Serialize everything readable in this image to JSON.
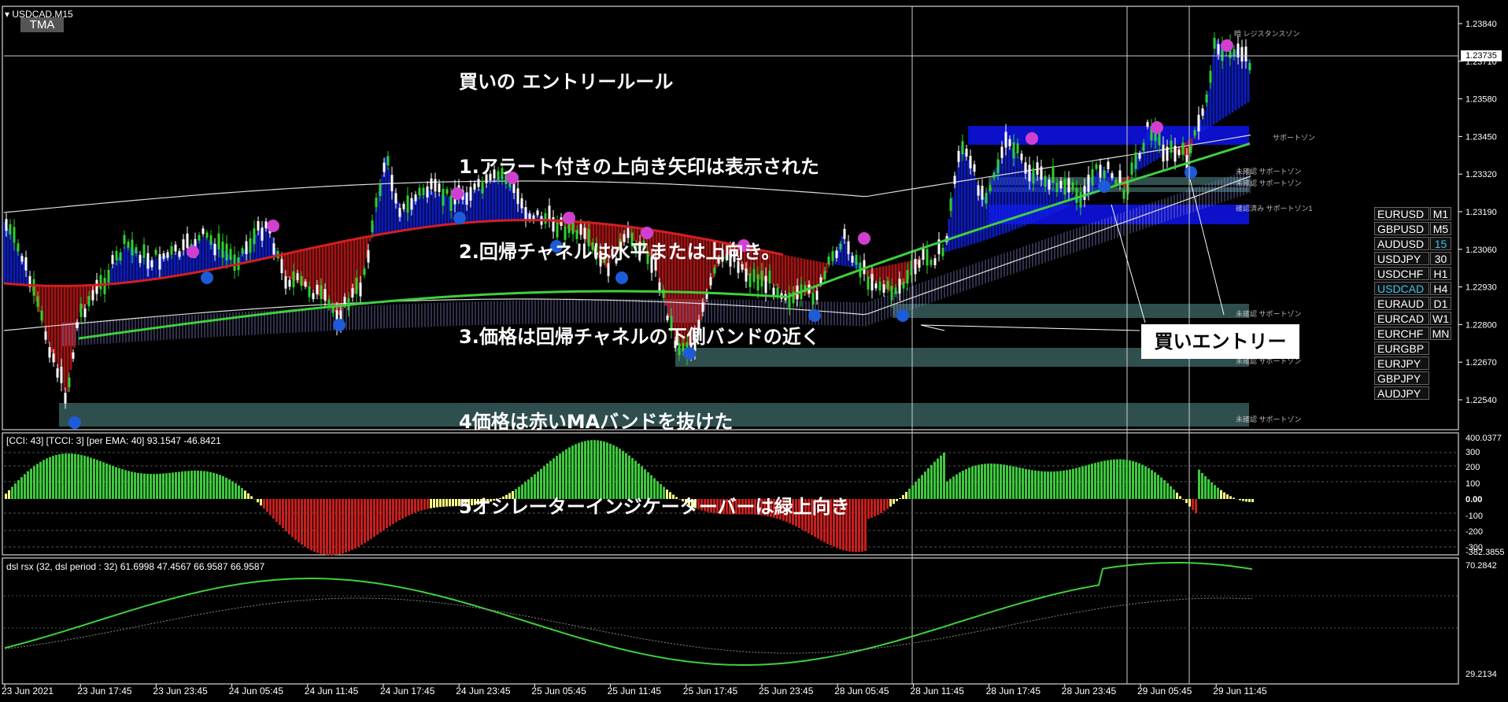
{
  "window": {
    "title": "USDCAD,M15",
    "indicator_box": "TMA"
  },
  "rules": {
    "lines": [
      "買いの エントリールール",
      "1.アラート付きの上向き矢印は表示された",
      "2.回帰チャネルは水平または上向き。",
      "3.価格は回帰チャネルの下側バンドの近く",
      "4価格は赤いMAバンドを抜けた",
      "5オシレーターインジケーターバーは緑上向き"
    ]
  },
  "entry_label": "買いエントリー",
  "price_axis": {
    "labels": [
      "1.23840",
      "1.23710",
      "1.23580",
      "1.23450",
      "1.23320",
      "1.23190",
      "1.23060",
      "1.22930",
      "1.22800",
      "1.22670",
      "1.22540"
    ],
    "current_price": "1.23735"
  },
  "zone_labels": {
    "top_right": "暗 レジスタンスゾン",
    "support_1": "サポートゾン",
    "support_2": "未確認 サポートゾン",
    "support_3": "未確認 サポートゾン",
    "support_4": "確認済み サポートゾン1",
    "support_5": "未確認 サポートゾン",
    "support_6": "未確認 サポートゾン",
    "support_7": "未確認 サポートゾン"
  },
  "symbols": [
    {
      "pair": "EURUSD",
      "tf": "M1",
      "active": false,
      "tf_active": false
    },
    {
      "pair": "GBPUSD",
      "tf": "M5",
      "active": false,
      "tf_active": false
    },
    {
      "pair": "AUDUSD",
      "tf": "15",
      "active": false,
      "tf_active": true
    },
    {
      "pair": "USDJPY",
      "tf": "30",
      "active": false,
      "tf_active": false
    },
    {
      "pair": "USDCHF",
      "tf": "H1",
      "active": false,
      "tf_active": false
    },
    {
      "pair": "USDCAD",
      "tf": "H4",
      "active": true,
      "tf_active": false
    },
    {
      "pair": "EURAUD",
      "tf": "D1",
      "active": false,
      "tf_active": false
    },
    {
      "pair": "EURCAD",
      "tf": "W1",
      "active": false,
      "tf_active": false
    },
    {
      "pair": "EURCHF",
      "tf": "MN",
      "active": false,
      "tf_active": false
    },
    {
      "pair": "EURGBP",
      "tf": "",
      "active": false,
      "tf_active": false
    },
    {
      "pair": "EURJPY",
      "tf": "",
      "active": false,
      "tf_active": false
    },
    {
      "pair": "GBPJPY",
      "tf": "",
      "active": false,
      "tf_active": false
    },
    {
      "pair": "AUDJPY",
      "tf": "",
      "active": false,
      "tf_active": false
    }
  ],
  "cci": {
    "header": "[CCI: 43] [TCCI: 3] [per EMA: 40]  93.1547 -46.8421",
    "axis_labels": [
      "400.0377",
      "300",
      "200",
      "100",
      "0.00",
      "-100",
      "-200",
      "-300",
      "-382.3855"
    ]
  },
  "rsx": {
    "header": "dsl rsx (32, dsl period : 32) 61.6998 47.4567 66.9587 66.9587",
    "axis_labels": [
      "70.2842",
      "29.2134"
    ]
  },
  "time_axis": [
    "23 Jun 2021",
    "23 Jun 17:45",
    "23 Jun 23:45",
    "24 Jun 05:45",
    "24 Jun 11:45",
    "24 Jun 17:45",
    "24 Jun 23:45",
    "25 Jun 05:45",
    "25 Jun 11:45",
    "25 Jun 17:45",
    "25 Jun 23:45",
    "28 Jun 05:45",
    "28 Jun 11:45",
    "28 Jun 17:45",
    "28 Jun 23:45",
    "29 Jun 05:45",
    "29 Jun 11:45"
  ],
  "colors": {
    "bull_candle": "#2fd02f",
    "bear_candle": "#ffffff",
    "ma_red": "#d02020",
    "ma_green": "#3fd03f",
    "blue_band": "#1020e0",
    "red_band": "#c01818",
    "zone_gray": "#2f4f4f",
    "zone_blue": "#0c10c8",
    "buy_arrow": "#1e5bd8",
    "sell_arrow": "#d040d0",
    "cci_green": "#3ec83e",
    "cci_red": "#c81e1e",
    "cci_yellow": "#ffff80"
  }
}
